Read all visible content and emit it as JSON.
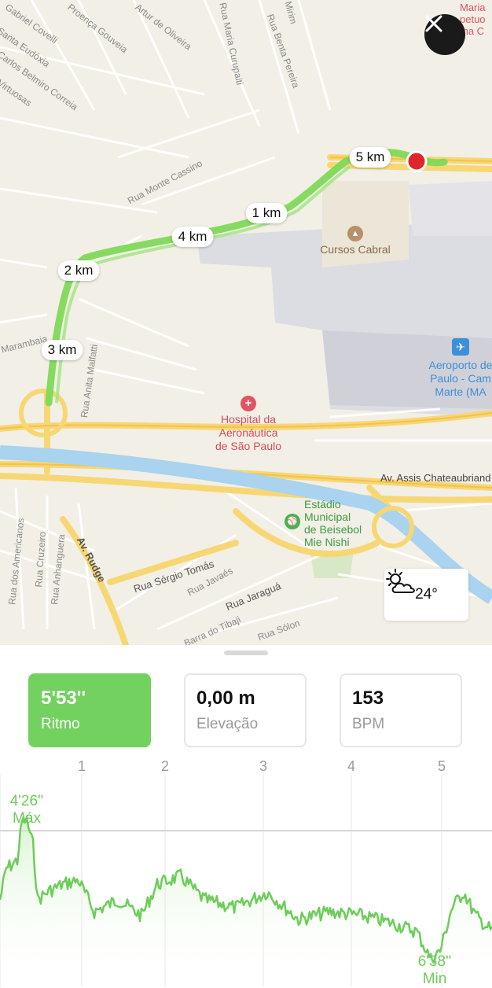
{
  "app": {
    "close_icon": "close-icon"
  },
  "map": {
    "streets": [
      "Gabriel Covelli",
      "Santa Eudóxia",
      "Carlos Belmiro Correia",
      "Virtuosas",
      "Proença Gouveia",
      "Artur de Oliveira",
      "Rua Maria Curupaiti",
      "Rua Benta Pereira",
      "Rua Monte Cassino",
      "Marambaia",
      "Rua Anita Malfatti",
      "Rua dos Americanos",
      "Rua Cruzeiro",
      "Rua Anhanguera",
      "Av. Rudge",
      "Rua Sérgio Tomás",
      "Rua Javaés",
      "Rua Jaraguá",
      "Barra do Tibaji",
      "Rua Sólon",
      "Av. Assis Chateaubriand",
      "Mirim"
    ],
    "km_markers": [
      "5 km",
      "1 km",
      "4 km",
      "2 km",
      "3 km"
    ],
    "pois": {
      "school": "Cursos Cabral",
      "hospital": "Hospital da\nAeronáutica\nde São Paulo",
      "airport": "Aeroporto de\nPaulo - Cam\nMarte (MA",
      "stadium": "Estádio\nMunicipal\nde Beisebol\nMie Nishi",
      "top_right": "Maria\npetuo\nma C"
    },
    "colors": {
      "route": "#7ed957",
      "hospital": "#e05561",
      "airport": "#3d8fd9",
      "stadium": "#4caf50",
      "end_point": "#e0262b"
    }
  },
  "weather": {
    "temperature": "24°",
    "icon": "partly-cloudy-icon"
  },
  "stats": [
    {
      "value": "5'53''",
      "label": "Ritmo"
    },
    {
      "value": "0,00 m",
      "label": "Elevação"
    },
    {
      "value": "153",
      "label": "BPM"
    }
  ],
  "chart_data": {
    "type": "area",
    "series": "pace",
    "x_ticks": [
      "1",
      "2",
      "3",
      "4",
      "5"
    ],
    "max_label": {
      "value": "4'26''",
      "label": "Máx"
    },
    "min_label": {
      "value": "6'38''",
      "label": "Min"
    },
    "color": "#6ccd59"
  }
}
